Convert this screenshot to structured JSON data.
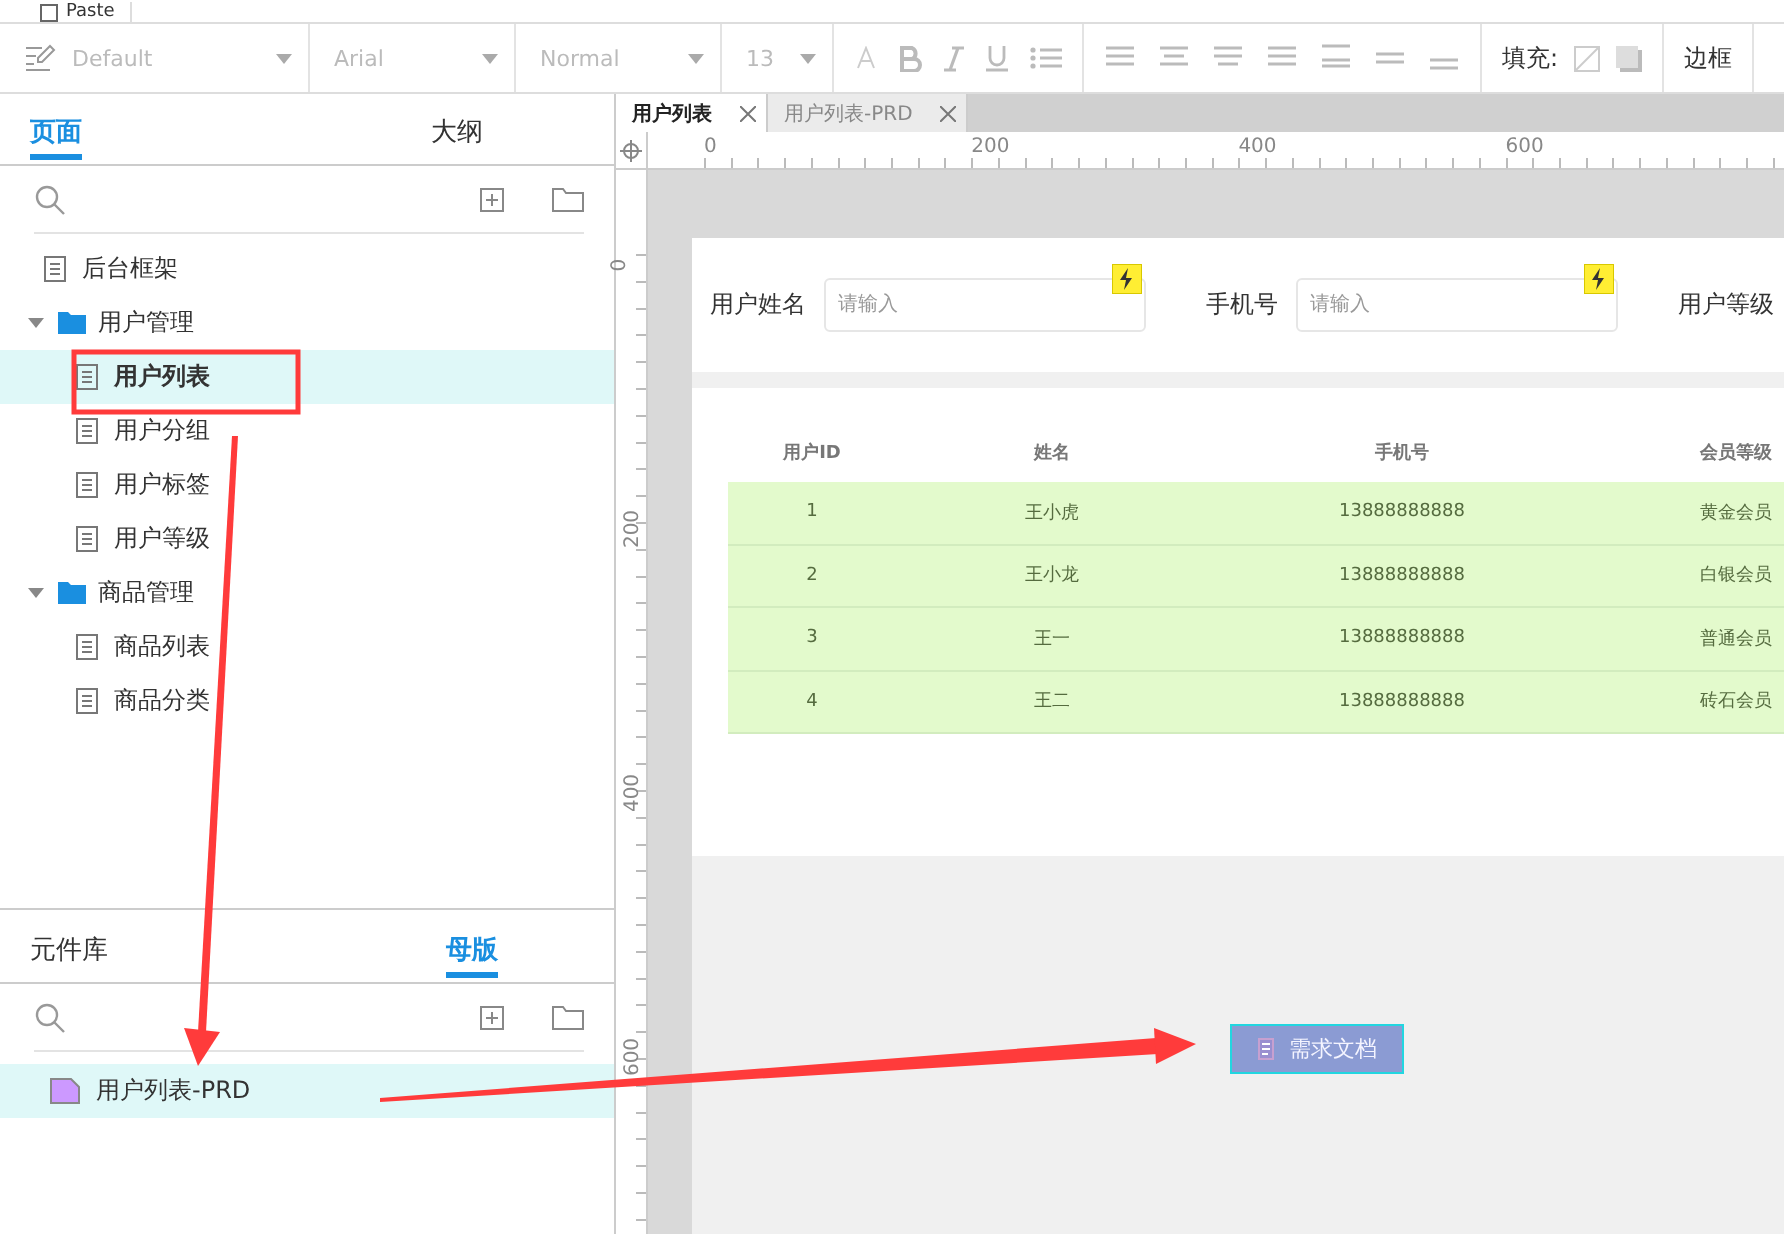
{
  "top_bar": {
    "paste_label": "Paste"
  },
  "toolbar": {
    "style": "Default",
    "font": "Arial",
    "weight": "Normal",
    "size": "13",
    "fill_label": "填充:",
    "border_label": "边框"
  },
  "pages_panel": {
    "tabs": [
      {
        "label": "页面",
        "selected": true
      },
      {
        "label": "大纲",
        "selected": false
      }
    ],
    "tree": [
      {
        "label": "后台框架",
        "kind": "page",
        "selected": false
      },
      {
        "label": "用户管理",
        "kind": "folder",
        "expanded": true,
        "children": [
          {
            "label": "用户列表",
            "kind": "page",
            "selected": true
          },
          {
            "label": "用户分组",
            "kind": "page",
            "selected": false
          },
          {
            "label": "用户标签",
            "kind": "page",
            "selected": false
          },
          {
            "label": "用户等级",
            "kind": "page",
            "selected": false
          }
        ]
      },
      {
        "label": "商品管理",
        "kind": "folder",
        "expanded": true,
        "children": [
          {
            "label": "商品列表",
            "kind": "page",
            "selected": false
          },
          {
            "label": "商品分类",
            "kind": "page",
            "selected": false
          }
        ]
      }
    ]
  },
  "masters_panel": {
    "tabs": [
      {
        "label": "元件库",
        "selected": false
      },
      {
        "label": "母版",
        "selected": true
      }
    ],
    "items": [
      {
        "label": "用户列表-PRD",
        "selected": true
      }
    ]
  },
  "editor_tabs": [
    {
      "label": "用户列表",
      "selected": true
    },
    {
      "label": "用户列表-PRD",
      "selected": false
    }
  ],
  "ruler": {
    "x_labels": [
      "0",
      "200",
      "400",
      "600"
    ],
    "y_labels": [
      "0",
      "200",
      "400",
      "600"
    ]
  },
  "canvas": {
    "filters": [
      {
        "label": "用户姓名",
        "placeholder": "请输入"
      },
      {
        "label": "手机号",
        "placeholder": "请输入"
      },
      {
        "label": "用户等级"
      }
    ],
    "table": {
      "columns": [
        "用户ID",
        "姓名",
        "手机号",
        "会员等级"
      ],
      "rows": [
        [
          "1",
          "王小虎",
          "13888888888",
          "黄金会员"
        ],
        [
          "2",
          "王小龙",
          "13888888888",
          "白银会员"
        ],
        [
          "3",
          "王一",
          "13888888888",
          "普通会员"
        ],
        [
          "4",
          "王二",
          "13888888888",
          "砖石会员"
        ]
      ]
    },
    "doc_button": "需求文档"
  }
}
